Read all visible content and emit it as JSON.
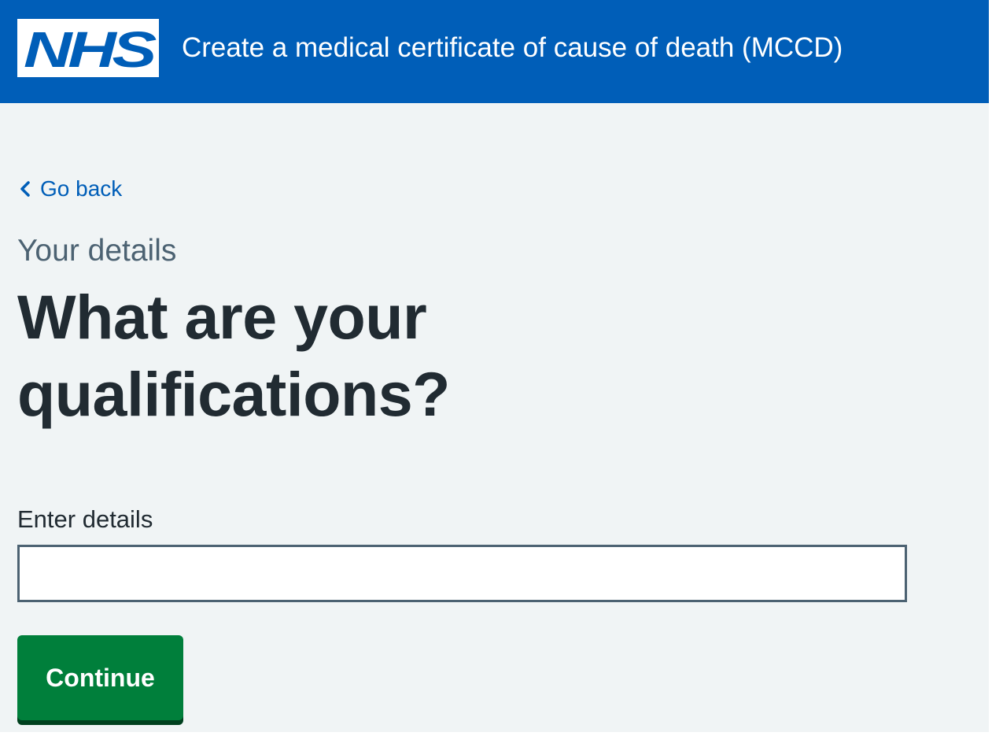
{
  "header": {
    "logo_text": "NHS",
    "service_name": "Create a medical certificate of cause of death (MCCD)"
  },
  "back_link": {
    "icon": "chevron-left-icon",
    "label": "Go back"
  },
  "page": {
    "caption": "Your details",
    "heading": "What are your qualifications?"
  },
  "form": {
    "field_label": "Enter details",
    "field_value": "",
    "continue_label": "Continue"
  },
  "colors": {
    "nhs_blue": "#005eb8",
    "background": "#f0f4f5",
    "text": "#212b32",
    "secondary_text": "#4c6272",
    "button_green": "#007f3b",
    "button_shadow": "#00401e"
  }
}
